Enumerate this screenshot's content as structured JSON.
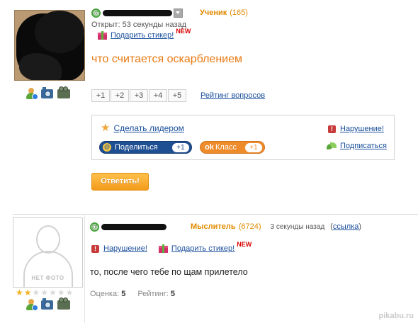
{
  "question": {
    "user_rank": "Ученик",
    "user_rank_count": "(165)",
    "opened": "Открыт: 53 секунды назад",
    "gift_link": "Подарить стикер!",
    "new_badge": "NEW",
    "title": "что считается оскарблением",
    "rating_buttons": [
      "+1",
      "+2",
      "+3",
      "+4",
      "+5"
    ],
    "rating_link": "Рейтинг вопросов",
    "make_leader": "Сделать лидером",
    "share_label": "Поделиться",
    "share_count": "+1",
    "class_label": "Класс",
    "class_count": "+1",
    "violation": "Нарушение!",
    "subscribe": "Подписаться",
    "answer_button": "Ответить!"
  },
  "answer": {
    "no_photo": "НЕТ ФОТО",
    "user_rank": "Мыслитель",
    "user_rank_count": "(6724)",
    "time": "3 секунды назад",
    "link_open": "(",
    "link_text": "ссылка",
    "link_close": ")",
    "violation": "Нарушение!",
    "gift_link": "Подарить стикер!",
    "new_badge": "NEW",
    "text": "то, после чего тебе по щам прилетело",
    "score_label": "Оценка:",
    "score_value": "5",
    "rating_label": "Рейтинг:",
    "rating_value": "5",
    "stars_filled": 2,
    "stars_total": 7
  },
  "watermark": "pikabu.ru",
  "colors": {
    "orange_title": "#e87a13",
    "link_blue": "#1a4f9c",
    "share_blue": "#1f4f93",
    "class_orange": "#ee8b2b",
    "answer_button": "#f39b1a"
  }
}
